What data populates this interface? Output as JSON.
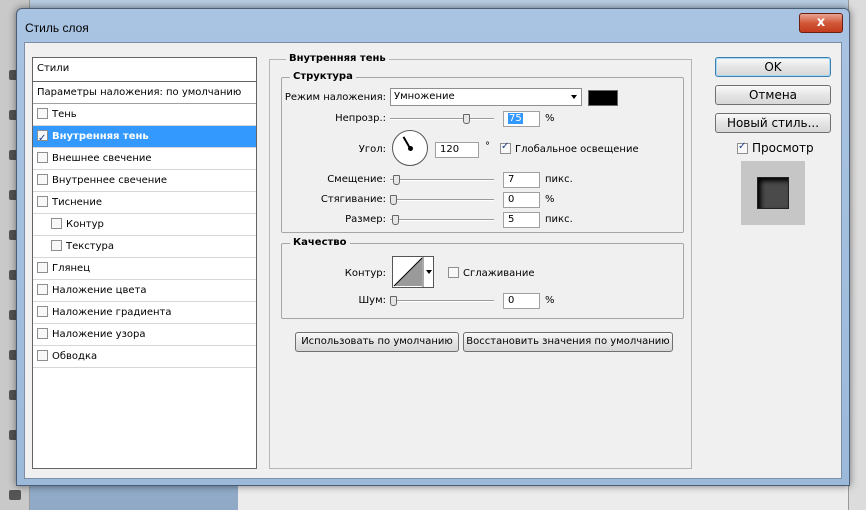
{
  "window": {
    "title": "Стиль слоя",
    "close_label": "x"
  },
  "styles_list": {
    "header": "Стили",
    "blend_options": "Параметры наложения: по умолчанию",
    "items": [
      {
        "label": "Тень",
        "checked": false,
        "selected": false,
        "sub": false
      },
      {
        "label": "Внутренняя тень",
        "checked": true,
        "selected": true,
        "sub": false
      },
      {
        "label": "Внешнее свечение",
        "checked": false,
        "selected": false,
        "sub": false
      },
      {
        "label": "Внутреннее свечение",
        "checked": false,
        "selected": false,
        "sub": false
      },
      {
        "label": "Тиснение",
        "checked": false,
        "selected": false,
        "sub": false
      },
      {
        "label": "Контур",
        "checked": false,
        "selected": false,
        "sub": true
      },
      {
        "label": "Текстура",
        "checked": false,
        "selected": false,
        "sub": true
      },
      {
        "label": "Глянец",
        "checked": false,
        "selected": false,
        "sub": false
      },
      {
        "label": "Наложение цвета",
        "checked": false,
        "selected": false,
        "sub": false
      },
      {
        "label": "Наложение градиента",
        "checked": false,
        "selected": false,
        "sub": false
      },
      {
        "label": "Наложение узора",
        "checked": false,
        "selected": false,
        "sub": false
      },
      {
        "label": "Обводка",
        "checked": false,
        "selected": false,
        "sub": false
      }
    ]
  },
  "inner_shadow": {
    "title": "Внутренняя тень",
    "structure": {
      "title": "Структура",
      "blend_mode_label": "Режим наложения:",
      "blend_mode_value": "Умножение",
      "shadow_color": "#000000",
      "opacity_label": "Непрозр.:",
      "opacity_value": "75",
      "opacity_unit": "%",
      "opacity_fraction": 0.75,
      "angle_label": "Угол:",
      "angle_value": "120",
      "angle_unit": "°",
      "global_light_label": "Глобальное освещение",
      "global_light_checked": true,
      "distance_label": "Смещение:",
      "distance_value": "7",
      "distance_unit": "пикс.",
      "choke_label": "Стягивание:",
      "choke_value": "0",
      "choke_unit": "%",
      "size_label": "Размер:",
      "size_value": "5",
      "size_unit": "пикс."
    },
    "quality": {
      "title": "Качество",
      "contour_label": "Контур:",
      "antialias_label": "Сглаживание",
      "antialias_checked": false,
      "noise_label": "Шум:",
      "noise_value": "0",
      "noise_unit": "%"
    },
    "make_default_label": "Использовать по умолчанию",
    "reset_default_label": "Восстановить значения по умолчанию"
  },
  "buttons": {
    "ok": "OK",
    "cancel": "Отмена",
    "new_style": "Новый стиль...",
    "preview_label": "Просмотр",
    "preview_checked": true
  }
}
